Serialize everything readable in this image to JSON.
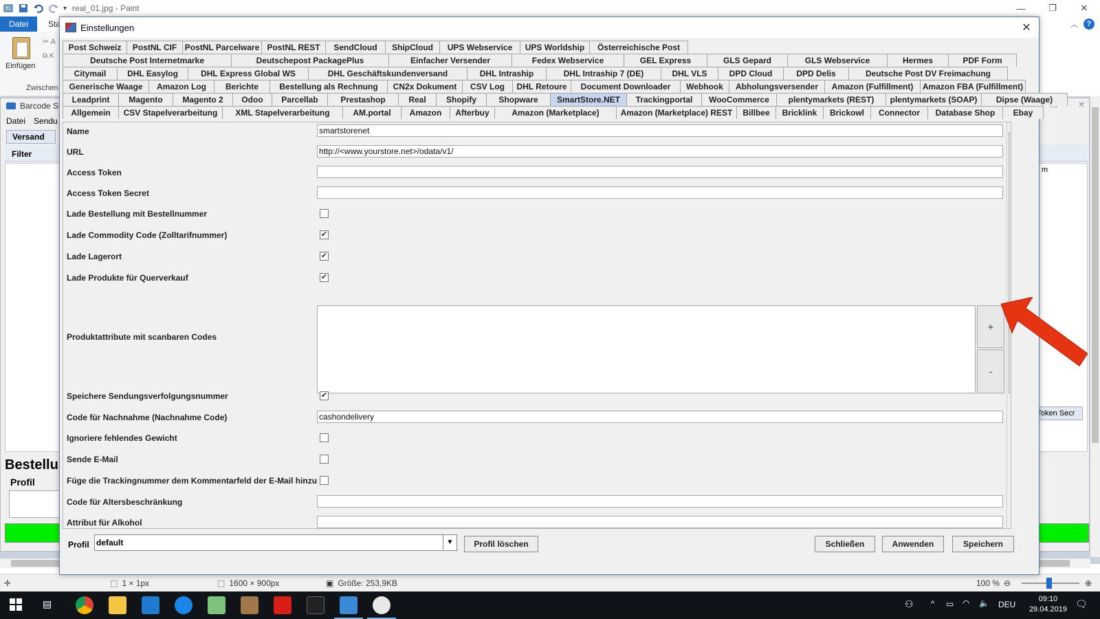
{
  "paint": {
    "title": "real_01.jpg - Paint",
    "ribbon": {
      "datei": "Datei",
      "start": "Sta",
      "einfugen": "Einfügen",
      "zwischen": "Zwischen"
    },
    "status": {
      "selection": "1 × 1px",
      "dimensions": "1600 × 900px",
      "size": "Größe: 253,9KB",
      "zoom": "100 %"
    }
  },
  "background_app": {
    "title": "Barcode Sh",
    "menu": [
      "Datei",
      "Sendu"
    ],
    "tab": "Versand",
    "filter": "Filter",
    "bestellung": "Bestellu",
    "profil": "Profil",
    "right_field": "s Token Secr",
    "right_m": "m"
  },
  "dialog": {
    "title": "Einstellungen",
    "tab_rows": [
      [
        "Post Schweiz",
        "PostNL CIF",
        "PostNL Parcelware",
        "PostNL REST",
        "SendCloud",
        "ShipCloud",
        "UPS Webservice",
        "UPS Worldship",
        "Österreichische Post"
      ],
      [
        "Deutsche Post Internetmarke",
        "Deutschepost PackagePlus",
        "Einfacher Versender",
        "Fedex Webservice",
        "GEL Express",
        "GLS Gepard",
        "GLS Webservice",
        "Hermes",
        "PDF Form"
      ],
      [
        "Citymail",
        "DHL Easylog",
        "DHL Express Global WS",
        "DHL Geschäftskundenversand",
        "DHL Intraship",
        "DHL Intraship 7 (DE)",
        "DHL VLS",
        "DPD Cloud",
        "DPD Delis",
        "Deutsche Post DV Freimachung"
      ],
      [
        "Generische Waage",
        "Amazon Log",
        "Berichte",
        "Bestellung als Rechnung",
        "CN2x Dokument",
        "CSV Log",
        "DHL Retoure",
        "Document Downloader",
        "Webhook",
        "Abholungsversender",
        "Amazon (Fulfillment)",
        "Amazon FBA (Fulfillment)"
      ],
      [
        "Leadprint",
        "Magento",
        "Magento 2",
        "Odoo",
        "Parcellab",
        "Prestashop",
        "Real",
        "Shopify",
        "Shopware",
        "SmartStore.NET",
        "Trackingportal",
        "WooCommerce",
        "plentymarkets (REST)",
        "plentymarkets (SOAP)",
        "Dipse (Waage)"
      ],
      [
        "Allgemein",
        "CSV Stapelverarbeitung",
        "XML Stapelverarbeitung",
        "AM.portal",
        "Amazon",
        "Afterbuy",
        "Amazon (Marketplace)",
        "Amazon (Marketplace) REST",
        "Billbee",
        "Bricklink",
        "Brickowl",
        "Connector",
        "Database Shop",
        "Ebay"
      ]
    ],
    "active_tab": "SmartStore.NET",
    "fields": {
      "name": {
        "label": "Name",
        "value": "smartstorenet"
      },
      "url": {
        "label": "URL",
        "value": "http://<www.yourstore.net>/odata/v1/"
      },
      "access_token": {
        "label": "Access Token",
        "value": ""
      },
      "access_token_secret": {
        "label": "Access Token Secret",
        "value": ""
      },
      "lade_bestellung": {
        "label": "Lade Bestellung mit Bestellnummer",
        "checked": false
      },
      "lade_commodity": {
        "label": "Lade Commodity Code (Zolltarifnummer)",
        "checked": true
      },
      "lade_lagerort": {
        "label": "Lade Lagerort",
        "checked": true
      },
      "lade_produkte": {
        "label": "Lade Produkte für Querverkauf",
        "checked": true
      },
      "produktattribute": {
        "label": "Produktattribute mit scanbaren Codes",
        "plus": "+",
        "minus": "-"
      },
      "speichere": {
        "label": "Speichere Sendungsverfolgungsnummer",
        "checked": true
      },
      "nachnahme": {
        "label": "Code für Nachnahme (Nachnahme Code)",
        "value": "cashondelivery"
      },
      "ignoriere": {
        "label": "Ignoriere fehlendes Gewicht",
        "checked": false
      },
      "sende_email": {
        "label": "Sende E-Mail",
        "checked": false
      },
      "fuege_tracking": {
        "label": "Füge die Trackingnummer dem Kommentarfeld der E-Mail hinzu",
        "checked": false
      },
      "alters": {
        "label": "Code für Altersbeschränkung",
        "value": ""
      },
      "alkohol": {
        "label": "Attribut für Alkohol",
        "value": ""
      }
    },
    "bottom": {
      "profil_label": "Profil",
      "profil_value": "default",
      "profil_loeschen": "Profil löschen",
      "schliessen": "Schließen",
      "anwenden": "Anwenden",
      "speichern": "Speichern"
    }
  },
  "taskbar": {
    "language": "DEU",
    "time": "09:10",
    "date": "29.04.2019"
  },
  "colors": {
    "active_tab": "#c6d7ef",
    "paint_accent": "#1e6ec8",
    "green_bar": "#00ee00",
    "annotation_arrow": "#e63312"
  }
}
